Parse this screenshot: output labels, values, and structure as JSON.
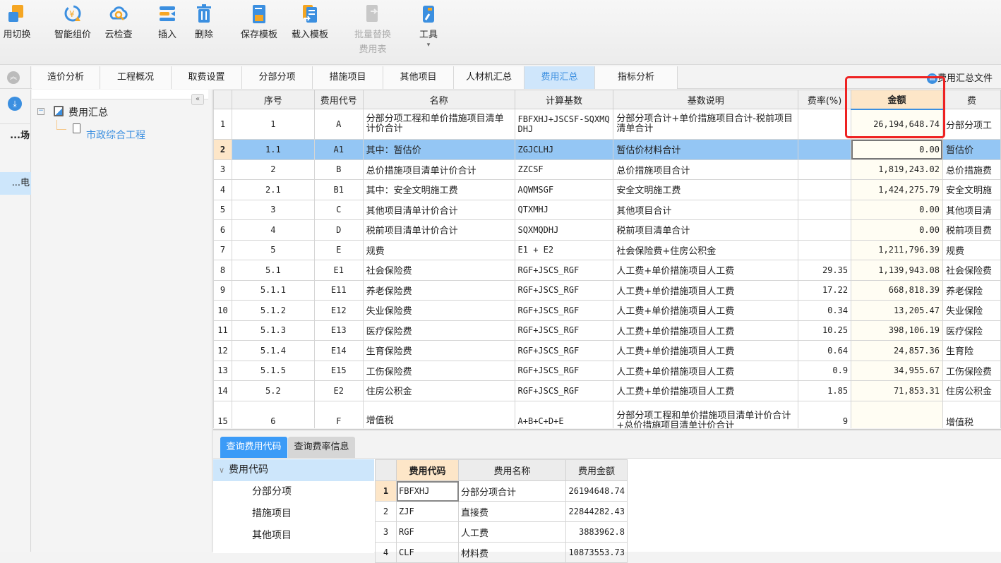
{
  "toolbar": {
    "buttons": [
      {
        "label": "用切换",
        "icon": "fee-switch-icon"
      },
      {
        "label": "智能组价",
        "icon": "smart-pricing-icon"
      },
      {
        "label": "云检查",
        "icon": "cloud-check-icon"
      },
      {
        "label": "插入",
        "icon": "insert-icon"
      },
      {
        "label": "删除",
        "icon": "delete-icon"
      },
      {
        "label": "保存模板",
        "icon": "save-template-icon"
      },
      {
        "label": "载入模板",
        "icon": "load-template-icon"
      },
      {
        "label": "批量替换",
        "sub": "费用表",
        "icon": "batch-replace-icon",
        "disabled": true
      },
      {
        "label": "工具",
        "sub": "▾",
        "icon": "tools-icon"
      }
    ]
  },
  "tabs": [
    "造价分析",
    "工程概况",
    "取费设置",
    "分部分项",
    "措施项目",
    "其他项目",
    "人材机汇总",
    "费用汇总",
    "指标分析"
  ],
  "active_tab": "费用汇总",
  "file_link": "费用汇总文件",
  "left_nav": {
    "item1": "场...",
    "item2": "电..."
  },
  "tree": {
    "root": "费用汇总",
    "child": "市政综合工程"
  },
  "grid": {
    "headers": [
      "",
      "序号",
      "费用代号",
      "名称",
      "计算基数",
      "基数说明",
      "费率(%)",
      "金额",
      "费"
    ],
    "rows": [
      [
        "1",
        "1",
        "A",
        "分部分项工程和单价措施项目清单计价合计",
        "FBFXHJ+JSCSF-SQXMQDHJ",
        "分部分项合计+单价措施项目合计-税前项目清单合计",
        "",
        "26,194,648.74",
        "分部分项工"
      ],
      [
        "2",
        "1.1",
        "A1",
        "其中：暂估价",
        "ZGJCLHJ",
        "暂估价材料合计",
        "",
        "0.00",
        "暂估价"
      ],
      [
        "3",
        "2",
        "B",
        "总价措施项目清单计价合计",
        "ZZCSF",
        "总价措施项目合计",
        "",
        "1,819,243.02",
        "总价措施费"
      ],
      [
        "4",
        "2.1",
        "B1",
        "其中：安全文明施工费",
        "AQWMSGF",
        "安全文明施工费",
        "",
        "1,424,275.79",
        "安全文明施"
      ],
      [
        "5",
        "3",
        "C",
        "其他项目清单计价合计",
        "QTXMHJ",
        "其他项目合计",
        "",
        "0.00",
        "其他项目清"
      ],
      [
        "6",
        "4",
        "D",
        "税前项目清单计价合计",
        "SQXMQDHJ",
        "税前项目清单合计",
        "",
        "0.00",
        "税前项目费"
      ],
      [
        "7",
        "5",
        "E",
        "规费",
        "E1 + E2",
        "社会保险费+住房公积金",
        "",
        "1,211,796.39",
        "规费"
      ],
      [
        "8",
        "5.1",
        "E1",
        "社会保险费",
        "RGF+JSCS_RGF",
        "人工费+单价措施项目人工费",
        "29.35",
        "1,139,943.08",
        "社会保险费"
      ],
      [
        "9",
        "5.1.1",
        "E11",
        "养老保险费",
        "RGF+JSCS_RGF",
        "人工费+单价措施项目人工费",
        "17.22",
        "668,818.39",
        "养老保险"
      ],
      [
        "10",
        "5.1.2",
        "E12",
        "失业保险费",
        "RGF+JSCS_RGF",
        "人工费+单价措施项目人工费",
        "0.34",
        "13,205.47",
        "失业保险"
      ],
      [
        "11",
        "5.1.3",
        "E13",
        "医疗保险费",
        "RGF+JSCS_RGF",
        "人工费+单价措施项目人工费",
        "10.25",
        "398,106.19",
        "医疗保险"
      ],
      [
        "12",
        "5.1.4",
        "E14",
        "生育保险费",
        "RGF+JSCS_RGF",
        "人工费+单价措施项目人工费",
        "0.64",
        "24,857.36",
        "生育险"
      ],
      [
        "13",
        "5.1.5",
        "E15",
        "工伤保险费",
        "RGF+JSCS_RGF",
        "人工费+单价措施项目人工费",
        "0.9",
        "34,955.67",
        "工伤保险费"
      ],
      [
        "14",
        "5.2",
        "E2",
        "住房公积金",
        "RGF+JSCS_RGF",
        "人工费+单价措施项目人工费",
        "1.85",
        "71,853.31",
        "住房公积金"
      ],
      [
        "15",
        "6",
        "F",
        "增值税",
        "A+B+C+D+E",
        "分部分项工程和单价措施项目清单计价合计+总价措施项目清单计价合计",
        "9",
        "",
        "增值税"
      ]
    ]
  },
  "bottom": {
    "tabs": [
      "查询费用代码",
      "查询费率信息"
    ],
    "tree": [
      "费用代码",
      "分部分项",
      "措施项目",
      "其他项目"
    ],
    "headers": [
      "",
      "费用代码",
      "费用名称",
      "费用金额"
    ],
    "rows": [
      [
        "1",
        "FBFXHJ",
        "分部分项合计",
        "26194648.74"
      ],
      [
        "2",
        "ZJF",
        "直接费",
        "22844282.43"
      ],
      [
        "3",
        "RGF",
        "人工费",
        "3883962.8"
      ],
      [
        "4",
        "CLF",
        "材料费",
        "10873553.73"
      ]
    ]
  }
}
